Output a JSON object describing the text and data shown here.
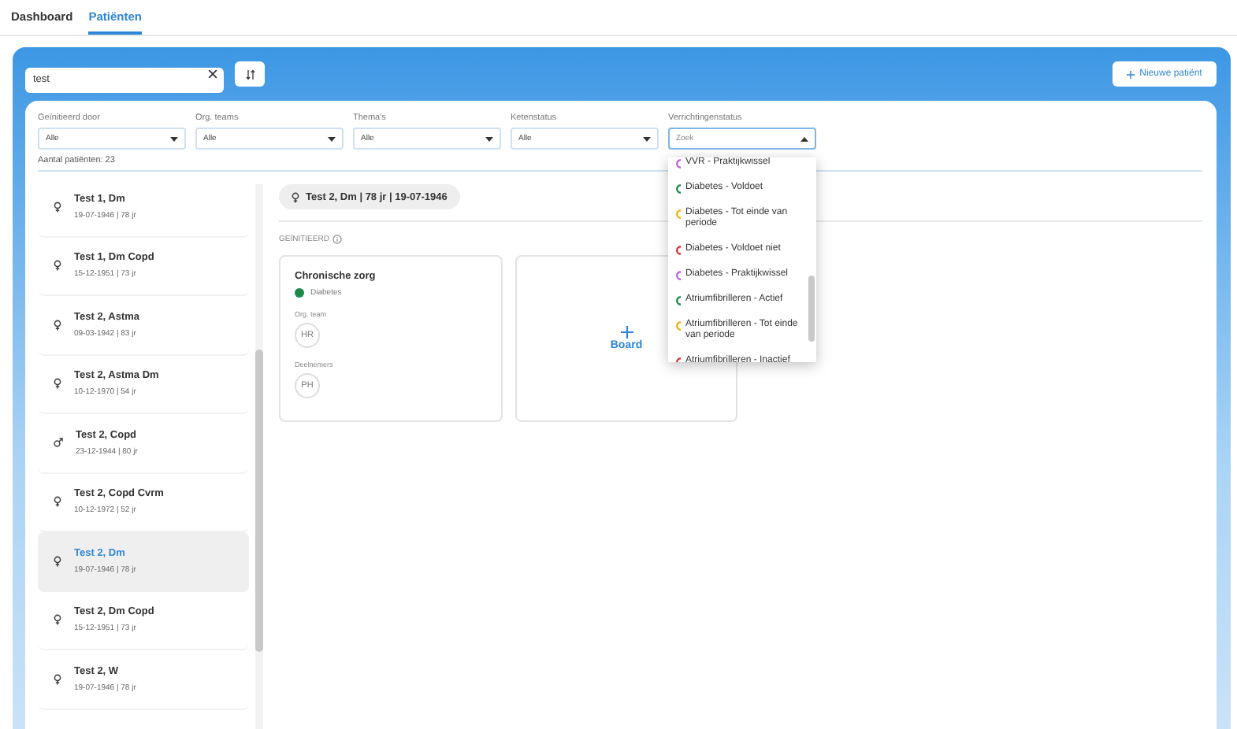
{
  "tabs": [
    {
      "label": "Dashboard",
      "selected": false
    },
    {
      "label": "Patiënten",
      "selected": true
    }
  ],
  "search": {
    "value": "test"
  },
  "new_patient_button": {
    "label": "Nieuwe patiënt"
  },
  "filters": [
    {
      "label": "Geïnitieerd door",
      "value": "Alle",
      "open": false
    },
    {
      "label": "Org. teams",
      "value": "Alle",
      "open": false
    },
    {
      "label": "Thema's",
      "value": "Alle",
      "open": false
    },
    {
      "label": "Ketenstatus",
      "value": "Alle",
      "open": false
    },
    {
      "label": "Verrichtingenstatus",
      "placeholder": "Zoek",
      "open": true
    }
  ],
  "patient_count": "Aantal patiënten: 23",
  "patients": [
    {
      "name": "Test 1, Dm",
      "details": "19-07-1946 | 78 jr",
      "kind": "female",
      "selected": false
    },
    {
      "name": "Test 1, Dm Copd",
      "details": "15-12-1951 | 73 jr",
      "kind": "female",
      "selected": false
    },
    {
      "name": "Test 2, Astma",
      "details": "09-03-1942 | 83 jr",
      "kind": "female",
      "selected": false
    },
    {
      "name": "Test 2, Astma Dm",
      "details": "10-12-1970 | 54 jr",
      "kind": "female",
      "selected": false
    },
    {
      "name": "Test 2, Copd",
      "details": "23-12-1944 | 80 jr",
      "kind": "male",
      "selected": false
    },
    {
      "name": "Test 2, Copd Cvrm",
      "details": "10-12-1972 | 52 jr",
      "kind": "female",
      "selected": false
    },
    {
      "name": "Test 2, Dm",
      "details": "19-07-1946 | 78 jr",
      "kind": "female",
      "selected": true
    },
    {
      "name": "Test 2, Dm Copd",
      "details": "15-12-1951 | 73 jr",
      "kind": "female",
      "selected": false
    },
    {
      "name": "Test 2, W",
      "details": "19-07-1946 | 78 jr",
      "kind": "female",
      "selected": false
    }
  ],
  "patient_header": {
    "label": "Test 2, Dm | 78 jr | 19-07-1946",
    "kind": "female"
  },
  "section_title": "GEÏNITIEERD",
  "care_card": {
    "title": "Chronische zorg",
    "theme": {
      "label": "Diabetes",
      "color": "#1a8a4a"
    },
    "team_label": "Org. team",
    "team": "HR",
    "participants_label": "Deelnemers",
    "participants": [
      "PH"
    ]
  },
  "add_board": {
    "label": "Board"
  },
  "status_options": [
    {
      "label": "VVR - Praktijkwissel",
      "color": "#c060d8"
    },
    {
      "label": "Diabetes - Voldoet",
      "color": "#1a8a4a"
    },
    {
      "label": "Diabetes - Tot einde van periode",
      "color": "#f0b400"
    },
    {
      "label": "Diabetes - Voldoet niet",
      "color": "#e03030"
    },
    {
      "label": "Diabetes - Praktijkwissel",
      "color": "#c060d8"
    },
    {
      "label": "Atriumfibrilleren - Actief",
      "color": "#1a8a4a"
    },
    {
      "label": "Atriumfibrilleren - Tot einde van periode",
      "color": "#f0b400"
    },
    {
      "label": "Atriumfibrilleren - Inactief",
      "color": "#e03030"
    }
  ]
}
